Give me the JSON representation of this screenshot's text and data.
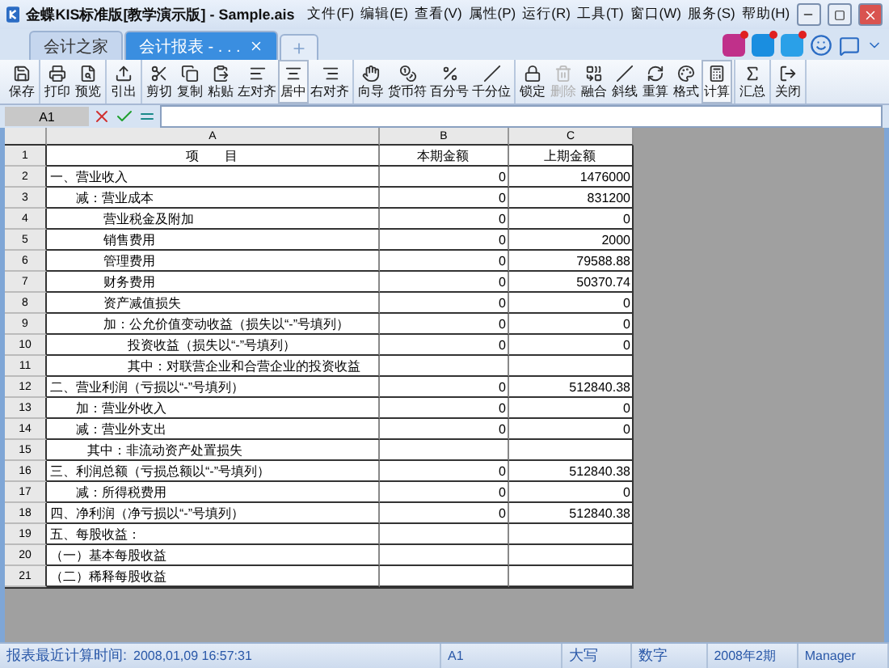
{
  "window": {
    "title": "金蝶KIS标准版[教学演示版] - Sample.ais"
  },
  "menu": [
    "文件(F)",
    "编辑(E)",
    "查看(V)",
    "属性(P)",
    "运行(R)",
    "工具(T)",
    "窗口(W)",
    "服务(S)",
    "帮助(H)"
  ],
  "tabs": [
    {
      "label": "会计之家",
      "selected": false,
      "closable": false
    },
    {
      "label": "会计报表 - . . .",
      "selected": true,
      "closable": true
    }
  ],
  "toolbar": [
    [
      {
        "label": "保存",
        "selected": false,
        "disabled": false
      }
    ],
    [
      {
        "label": "打印",
        "selected": false,
        "disabled": false
      },
      {
        "label": "预览",
        "selected": false,
        "disabled": false
      }
    ],
    [
      {
        "label": "引出",
        "selected": false,
        "disabled": false
      }
    ],
    [
      {
        "label": "剪切",
        "selected": false,
        "disabled": false
      },
      {
        "label": "复制",
        "selected": false,
        "disabled": false
      },
      {
        "label": "粘贴",
        "selected": false,
        "disabled": false
      },
      {
        "label": "左对齐",
        "selected": false,
        "disabled": false
      },
      {
        "label": "居中",
        "selected": true,
        "disabled": false
      },
      {
        "label": "右对齐",
        "selected": false,
        "disabled": false
      }
    ],
    [
      {
        "label": "向导",
        "selected": false,
        "disabled": false
      },
      {
        "label": "货币符",
        "selected": false,
        "disabled": false
      },
      {
        "label": "百分号",
        "selected": false,
        "disabled": false
      },
      {
        "label": "千分位",
        "selected": false,
        "disabled": false
      }
    ],
    [
      {
        "label": "锁定",
        "selected": false,
        "disabled": false
      },
      {
        "label": "删除",
        "selected": false,
        "disabled": true
      },
      {
        "label": "融合",
        "selected": false,
        "disabled": false
      },
      {
        "label": "斜线",
        "selected": false,
        "disabled": false
      },
      {
        "label": "重算",
        "selected": false,
        "disabled": false
      },
      {
        "label": "格式",
        "selected": false,
        "disabled": false
      },
      {
        "label": "计算",
        "selected": true,
        "disabled": false
      }
    ],
    [
      {
        "label": "汇总",
        "selected": false,
        "disabled": false
      }
    ],
    [
      {
        "label": "关闭",
        "selected": false,
        "disabled": false
      }
    ]
  ],
  "formula_bar": {
    "cell": "A1"
  },
  "sheet": {
    "columns": [
      "A",
      "B",
      "C"
    ],
    "rows": [
      {
        "number": "1",
        "kind": "title",
        "item": "项　　目",
        "current": "本期金额",
        "previous": "上期金额"
      },
      {
        "number": "2",
        "kind": "main",
        "item": "一、营业收入",
        "current": "0",
        "previous": "1476000"
      },
      {
        "number": "3",
        "kind": "deduct",
        "item": "减：营业成本",
        "current": "0",
        "previous": "831200"
      },
      {
        "number": "4",
        "kind": "item",
        "item": "营业税金及附加",
        "current": "0",
        "previous": "0"
      },
      {
        "number": "5",
        "kind": "item",
        "item": "销售费用",
        "current": "0",
        "previous": "2000"
      },
      {
        "number": "6",
        "kind": "item",
        "item": "管理费用",
        "current": "0",
        "previous": "79588.88"
      },
      {
        "number": "7",
        "kind": "item",
        "item": "财务费用",
        "current": "0",
        "previous": "50370.74"
      },
      {
        "number": "8",
        "kind": "item",
        "item": "资产减值损失",
        "current": "0",
        "previous": "0"
      },
      {
        "number": "9",
        "kind": "item",
        "item": "加：公允价值变动收益（损失以“-”号填列）",
        "current": "0",
        "previous": "0"
      },
      {
        "number": "10",
        "kind": "detail",
        "item": "投资收益（损失以“-”号填列）",
        "current": "0",
        "previous": "0"
      },
      {
        "number": "11",
        "kind": "detail",
        "item": "其中：对联营企业和合营企业的投资收益"
      },
      {
        "number": "12",
        "kind": "main",
        "item": "二、营业利润（亏损以“-”号填列）",
        "current": "0",
        "previous": "512840.38"
      },
      {
        "number": "13",
        "kind": "deduct",
        "item": "加：营业外收入",
        "current": "0",
        "previous": "0"
      },
      {
        "number": "14",
        "kind": "deduct",
        "item": "减：营业外支出",
        "current": "0",
        "previous": "0"
      },
      {
        "number": "15",
        "kind": "sub",
        "item": "其中：非流动资产处置损失"
      },
      {
        "number": "16",
        "kind": "main",
        "item": "三、利润总额（亏损总额以“-”号填列）",
        "current": "0",
        "previous": "512840.38"
      },
      {
        "number": "17",
        "kind": "deduct",
        "item": "减：所得税费用",
        "current": "0",
        "previous": "0"
      },
      {
        "number": "18",
        "kind": "main",
        "item": "四、净利润（净亏损以“-”号填列）",
        "current": "0",
        "previous": "512840.38"
      },
      {
        "number": "19",
        "kind": "main",
        "item": "五、每股收益："
      },
      {
        "number": "20",
        "kind": "main",
        "item": "（一）基本每股收益"
      },
      {
        "number": "21",
        "kind": "main",
        "item": "（二）稀释每股收益"
      }
    ]
  },
  "status_bar": {
    "label": "报表最近计算时间:",
    "time": "2008,01,09 16:57:31",
    "cell": "A1",
    "caps": "大写",
    "num": "数字",
    "period": "2008年2期",
    "user": "Manager"
  }
}
